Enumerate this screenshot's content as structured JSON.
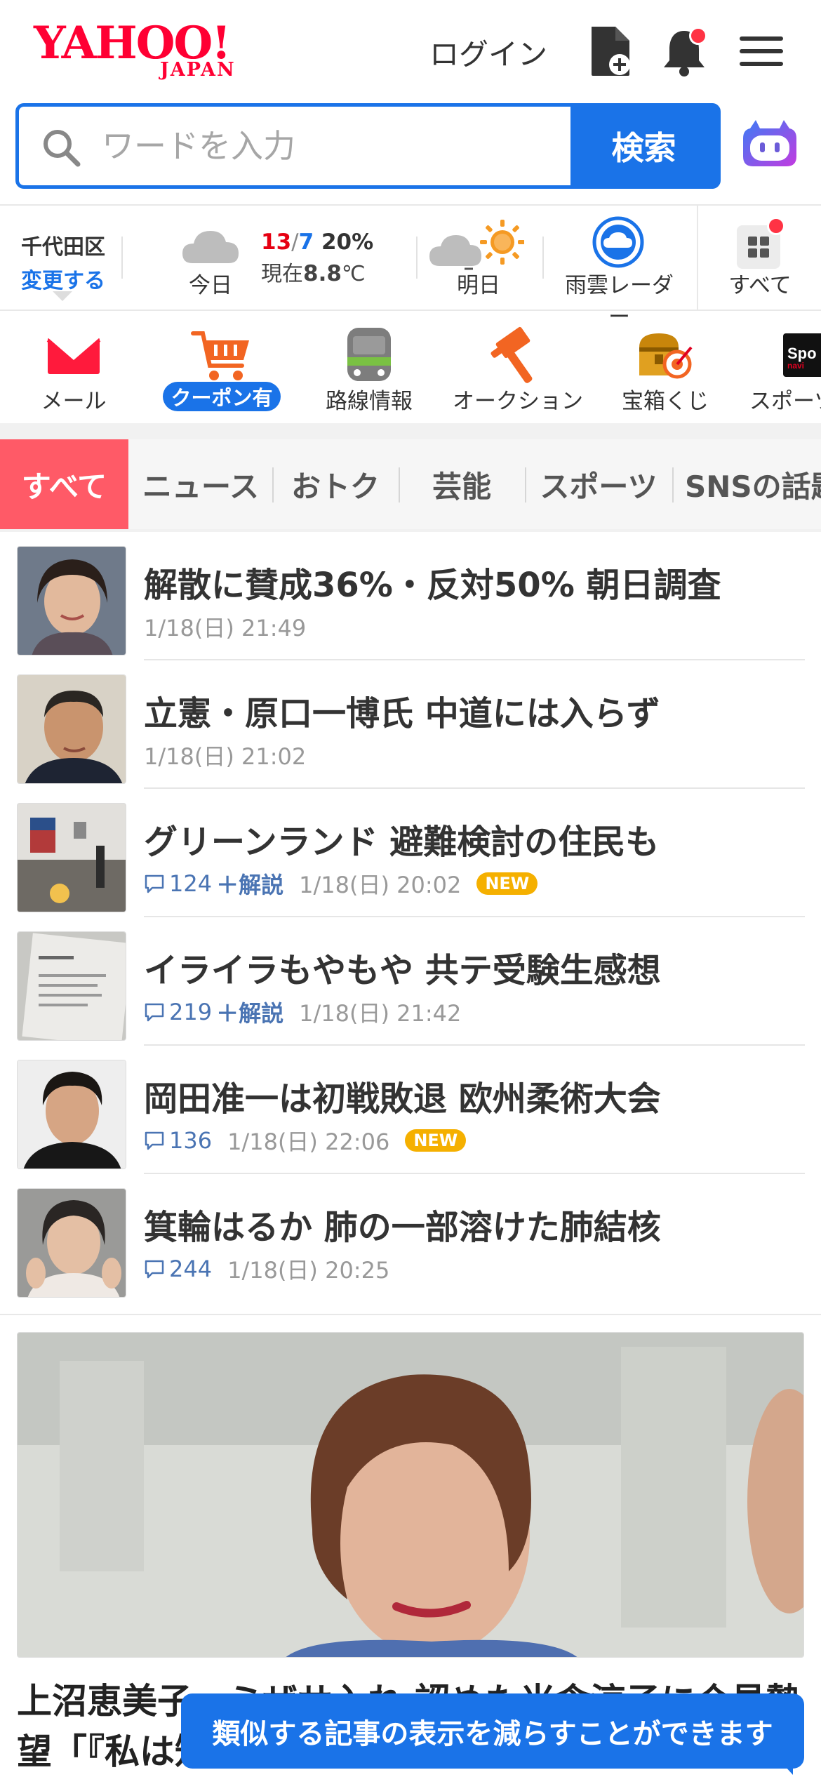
{
  "header": {
    "logo_main": "YAHOO!",
    "logo_sub": "JAPAN",
    "login_label": "ログイン"
  },
  "search": {
    "placeholder": "ワードを入力",
    "button_label": "検索"
  },
  "weather": {
    "location": "千代田区",
    "change_label": "変更する",
    "today_label": "今日",
    "temp_high": "13",
    "temp_sep": "/",
    "temp_low": "7",
    "rain_chance": "20%",
    "now_prefix": "現在",
    "now_temp": "8.8",
    "now_unit": "℃",
    "tomorrow_label": "明日",
    "radar_label": "雨雲レーダー",
    "all_label": "すべて"
  },
  "services": [
    {
      "label": "メール",
      "icon": "mail-icon"
    },
    {
      "label": "クーポン有",
      "icon": "shopping-cart-icon"
    },
    {
      "label": "路線情報",
      "icon": "train-icon"
    },
    {
      "label": "オークション",
      "icon": "auction-hammer-icon"
    },
    {
      "label": "宝箱くじ",
      "icon": "treasure-box-icon"
    },
    {
      "label": "スポーツ",
      "icon": "sports-icon"
    }
  ],
  "tabs": [
    "すべて",
    "ニュース",
    "おトク",
    "芸能",
    "スポーツ",
    "SNSの話題"
  ],
  "news": [
    {
      "title": "解散に賛成36%・反対50% 朝日調査",
      "date": "1/18(日) 21:49"
    },
    {
      "title": "立憲・原口一博氏 中道には入らず",
      "date": "1/18(日) 21:02"
    },
    {
      "title": "グリーンランド 避難検討の住民も",
      "comments": "124",
      "kaisetsu": "＋解説",
      "date": "1/18(日) 20:02",
      "badge": "NEW"
    },
    {
      "title": "イライラもやもや 共テ受験生感想",
      "comments": "219",
      "kaisetsu": "＋解説",
      "date": "1/18(日) 21:42"
    },
    {
      "title": "岡田准一は初戦敗退 欧州柔術大会",
      "comments": "136",
      "date": "1/18(日) 22:06",
      "badge": "NEW"
    },
    {
      "title": "箕輪はるか 肺の一部溶けた肺結核",
      "comments": "244",
      "date": "1/18(日) 20:25"
    }
  ],
  "feature": {
    "title": "上沼恵美子、ミザサ入れ 認めた米倉涼子に合見勢 望「『私は知"
  },
  "toast": {
    "message": "類似する記事の表示を減らすことができます"
  },
  "colors": {
    "brand_red": "#ff0033",
    "accent_blue": "#1a73e8",
    "tab_active": "#ff5a67",
    "new_badge": "#f5b000"
  }
}
